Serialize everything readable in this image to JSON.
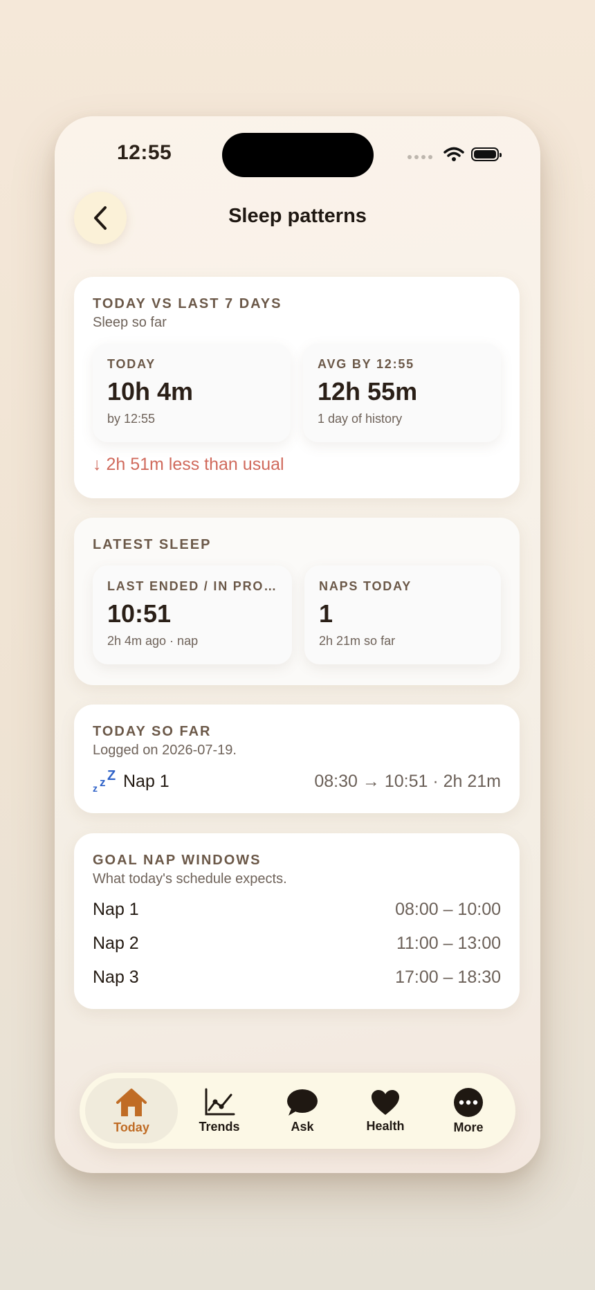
{
  "status_bar": {
    "time": "12:55"
  },
  "header": {
    "title": "Sleep patterns"
  },
  "comparison": {
    "title": "TODAY VS LAST 7 DAYS",
    "subtitle": "Sleep so far",
    "today": {
      "label": "TODAY",
      "value": "10h 4m",
      "note": "by 12:55"
    },
    "avg": {
      "label": "AVG BY 12:55",
      "value": "12h 55m",
      "note": "1 day of history"
    },
    "delta": "↓ 2h 51m less than usual",
    "delta_color": "#d06a5c"
  },
  "latest": {
    "title": "LATEST SLEEP",
    "last": {
      "label": "LAST ENDED / IN PRO…",
      "value": "10:51",
      "note": "2h 4m ago · nap"
    },
    "naps": {
      "label": "NAPS TODAY",
      "value": "1",
      "note": "2h 21m so far"
    }
  },
  "today_so_far": {
    "title": "TODAY SO FAR",
    "subtitle": "Logged on 2026-07-19.",
    "entries": [
      {
        "icon": "zzz-icon",
        "name": "Nap 1",
        "detail": "08:30 → 10:51 · 2h 21m"
      }
    ]
  },
  "goal_windows": {
    "title": "GOAL NAP WINDOWS",
    "subtitle": "What today's schedule expects.",
    "rows": [
      {
        "name": "Nap 1",
        "window": "08:00 – 10:00"
      },
      {
        "name": "Nap 2",
        "window": "11:00 – 13:00"
      },
      {
        "name": "Nap 3",
        "window": "17:00 – 18:30"
      }
    ]
  },
  "tabbar": {
    "accent": "#c06c25",
    "items": [
      {
        "label": "Today",
        "icon": "house-icon",
        "active": true
      },
      {
        "label": "Trends",
        "icon": "line-chart-icon"
      },
      {
        "label": "Ask",
        "icon": "speech-bubble-icon"
      },
      {
        "label": "Health",
        "icon": "heart-icon"
      },
      {
        "label": "More",
        "icon": "ellipsis-circle-icon"
      }
    ]
  }
}
